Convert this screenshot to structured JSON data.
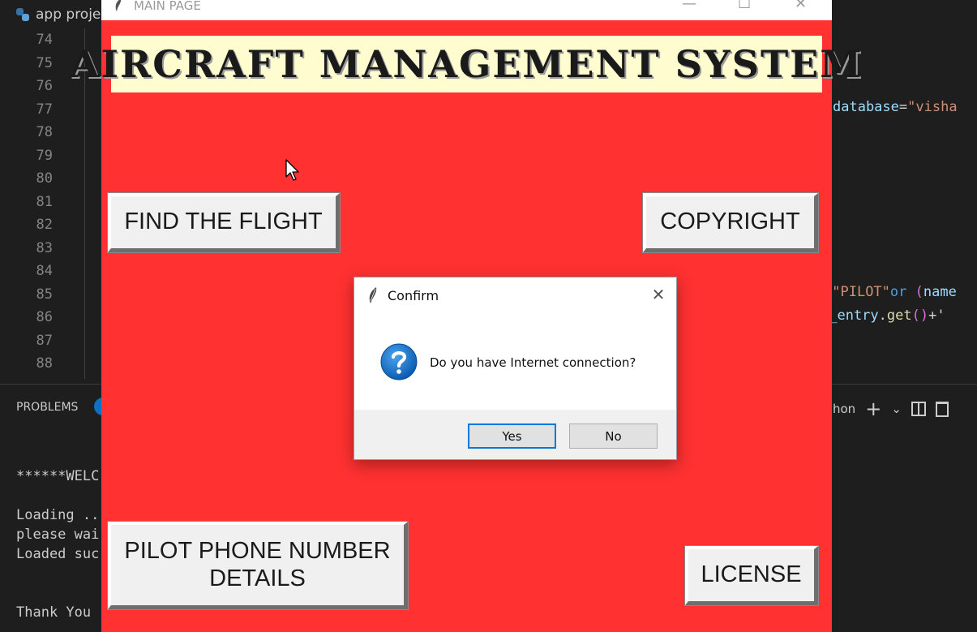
{
  "vscode": {
    "tab_label": "app proje",
    "line_numbers": [
      "74",
      "75",
      "76",
      "77",
      "78",
      "79",
      "80",
      "81",
      "82",
      "83",
      "84",
      "85",
      "86",
      "87",
      "88"
    ],
    "code_fragments": {
      "line77_var": "database",
      "line77_eq": "=",
      "line77_str": "\"visha",
      "line85_a": "=",
      "line85_str": "\"PILOT\"",
      "line85_kw": "or",
      "line85_paren": "(",
      "line85_var": "name",
      "line86_var": "m_entry",
      "line86_dot": ".",
      "line86_fn": "get",
      "line86_parens": "()",
      "line86_plus": "+'"
    },
    "panel": {
      "problems_label": "PROBLEMS",
      "python_label": "hon",
      "plus_label": "+",
      "chevron_label": "⌄"
    },
    "terminal_lines": [
      "******WELC",
      "Loading ..",
      "please wai",
      "Loaded suc",
      "Thank You"
    ]
  },
  "main_window": {
    "title": "MAIN PAGE",
    "banner": "AIRCRAFT MANAGEMENT SYSTEM",
    "buttons": {
      "find_flight": "FIND THE FLIGHT",
      "copyright": "COPYRIGHT",
      "pilot_line1": "PILOT PHONE NUMBER",
      "pilot_line2": "DETAILS",
      "license": "LICENSE"
    },
    "colors": {
      "background": "#ff3131",
      "banner_bg": "#fffdd0"
    }
  },
  "dialog": {
    "title": "Confirm",
    "message": "Do you have Internet connection?",
    "yes": "Yes",
    "no": "No",
    "close_glyph": "✕"
  }
}
